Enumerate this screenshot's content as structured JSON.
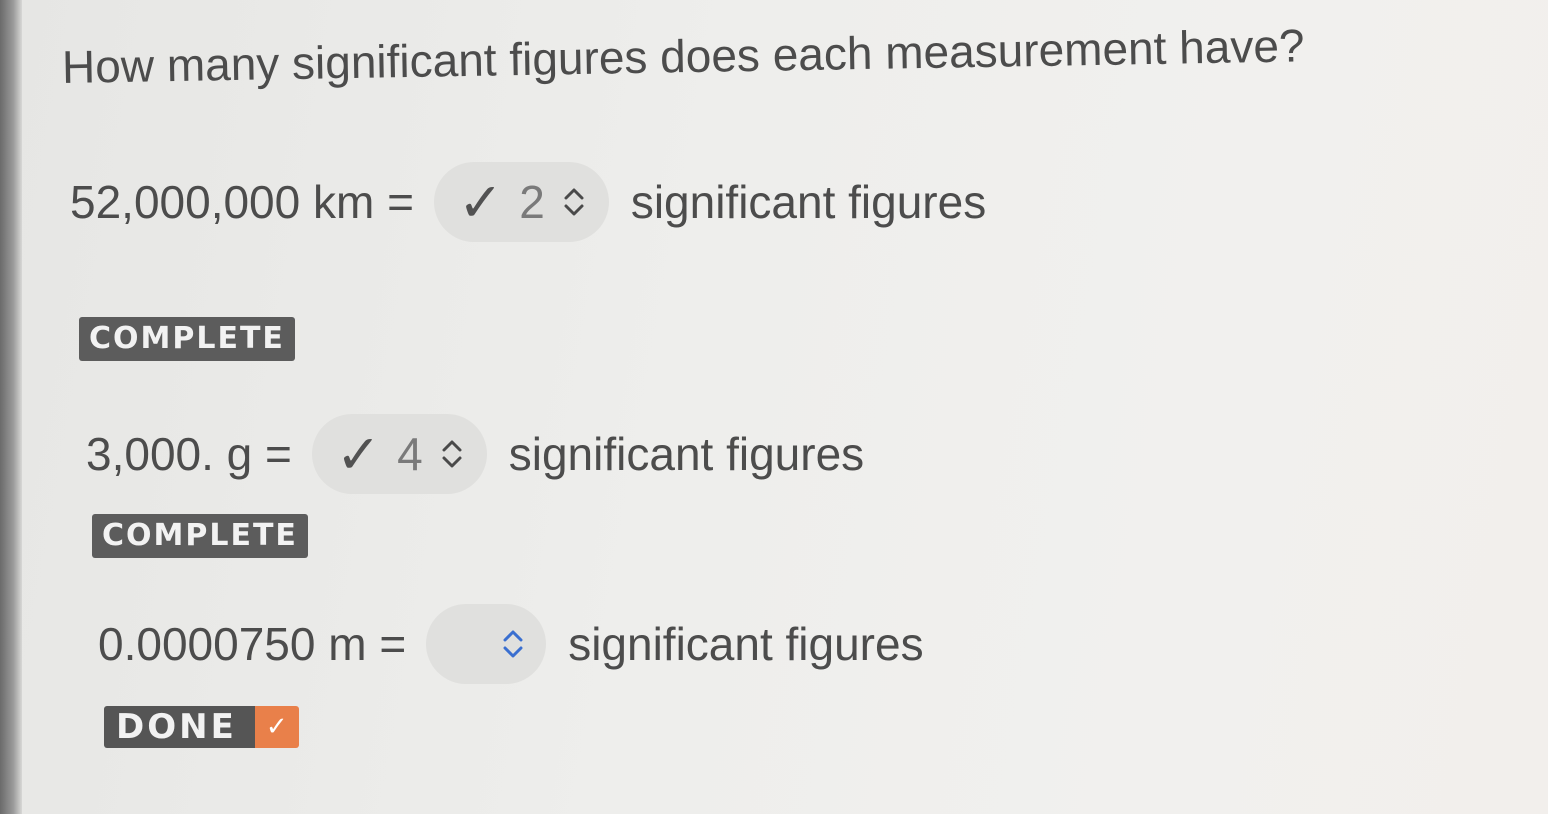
{
  "question": "How many significant figures does each measurement have?",
  "rows": [
    {
      "measurement": "52,000,000 km =",
      "selected": "2",
      "suffix": "significant figures",
      "status": "COMPLETE"
    },
    {
      "measurement": "3,000. g =",
      "selected": "4",
      "suffix": "significant figures",
      "status": "COMPLETE"
    },
    {
      "measurement": "0.0000750 m =",
      "selected": "",
      "suffix": "significant figures"
    }
  ],
  "done_button": {
    "label": "DONE"
  },
  "icons": {
    "answer_correct": "checkmark-icon",
    "select_toggle": "chevron-up-down-icon",
    "done_check": "checkmark-icon"
  },
  "colors": {
    "done_accent": "#e9804a",
    "badge_bg": "#5c5c5c",
    "select_bg": "#e0e0de"
  }
}
